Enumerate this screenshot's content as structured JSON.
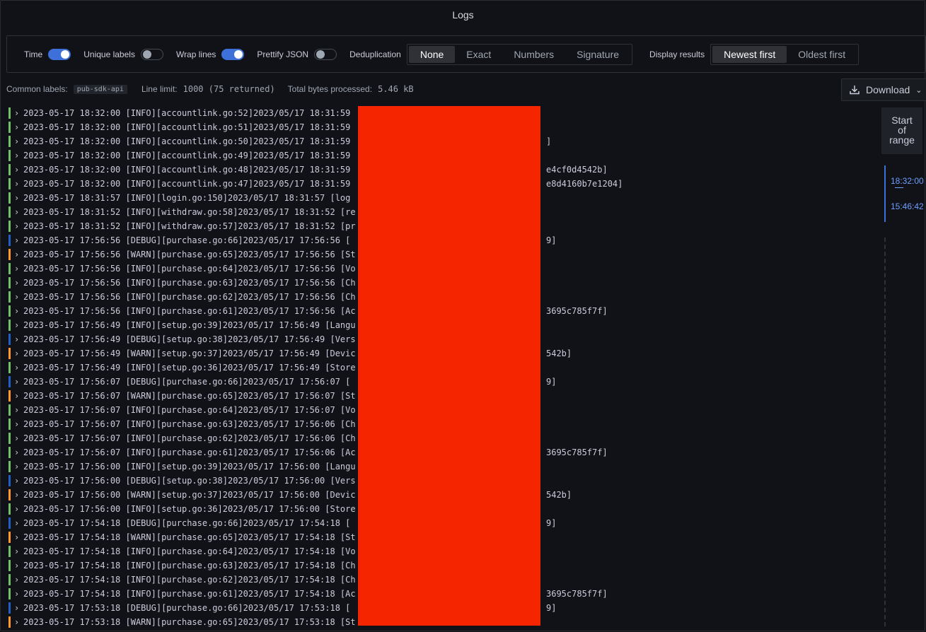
{
  "panel": {
    "title": "Logs"
  },
  "options": {
    "time": {
      "label": "Time",
      "on": true
    },
    "unique_labels": {
      "label": "Unique labels",
      "on": false
    },
    "wrap_lines": {
      "label": "Wrap lines",
      "on": true
    },
    "prettify_json": {
      "label": "Prettify JSON",
      "on": false
    },
    "dedup": {
      "label": "Deduplication",
      "choices": [
        "None",
        "Exact",
        "Numbers",
        "Signature"
      ],
      "selected": "None"
    },
    "display": {
      "label": "Display results",
      "choices": [
        "Newest first",
        "Oldest first"
      ],
      "selected": "Newest first"
    }
  },
  "meta": {
    "common_labels_label": "Common labels:",
    "common_labels_value": "pub-sdk-api",
    "line_limit_label": "Line limit:",
    "line_limit_value": "1000 (75 returned)",
    "bytes_label": "Total bytes processed:",
    "bytes_value": "5.46 kB"
  },
  "download": {
    "label": "Download"
  },
  "range": {
    "head": [
      "Start",
      "of",
      "range"
    ],
    "top": "18:32:00",
    "sep": "—",
    "bottom": "15:46:42"
  },
  "colors": {
    "info": "#73bf69",
    "debug": "#1f60c4",
    "warn": "#ff9830",
    "accent": "#3d71d9",
    "redaction": "#f52500"
  },
  "logs": [
    {
      "level": "info",
      "left": "2023-05-17 18:32:00 [INFO][accountlink.go:52]2023/05/17 18:31:59",
      "right": ""
    },
    {
      "level": "info",
      "left": "2023-05-17 18:32:00 [INFO][accountlink.go:51]2023/05/17 18:31:59",
      "right": ""
    },
    {
      "level": "info",
      "left": "2023-05-17 18:32:00 [INFO][accountlink.go:50]2023/05/17 18:31:59",
      "right": "]"
    },
    {
      "level": "info",
      "left": "2023-05-17 18:32:00 [INFO][accountlink.go:49]2023/05/17 18:31:59",
      "right": ""
    },
    {
      "level": "info",
      "left": "2023-05-17 18:32:00 [INFO][accountlink.go:48]2023/05/17 18:31:59",
      "right": "e4cf0d4542b]"
    },
    {
      "level": "info",
      "left": "2023-05-17 18:32:00 [INFO][accountlink.go:47]2023/05/17 18:31:59",
      "right": "e8d4160b7e1204]"
    },
    {
      "level": "info",
      "left": "2023-05-17 18:31:57 [INFO][login.go:150]2023/05/17 18:31:57 [log",
      "right": ""
    },
    {
      "level": "info",
      "left": "2023-05-17 18:31:52 [INFO][withdraw.go:58]2023/05/17 18:31:52 [re",
      "right": ""
    },
    {
      "level": "info",
      "left": "2023-05-17 18:31:52 [INFO][withdraw.go:57]2023/05/17 18:31:52 [pr",
      "right": ""
    },
    {
      "level": "debug",
      "left": "2023-05-17 17:56:56 [DEBUG][purchase.go:66]2023/05/17 17:56:56 [",
      "right": "9]"
    },
    {
      "level": "warn",
      "left": "2023-05-17 17:56:56 [WARN][purchase.go:65]2023/05/17 17:56:56 [St",
      "right": ""
    },
    {
      "level": "info",
      "left": "2023-05-17 17:56:56 [INFO][purchase.go:64]2023/05/17 17:56:56 [Vo",
      "right": ""
    },
    {
      "level": "info",
      "left": "2023-05-17 17:56:56 [INFO][purchase.go:63]2023/05/17 17:56:56 [Ch",
      "right": ""
    },
    {
      "level": "info",
      "left": "2023-05-17 17:56:56 [INFO][purchase.go:62]2023/05/17 17:56:56 [Ch",
      "right": ""
    },
    {
      "level": "info",
      "left": "2023-05-17 17:56:56 [INFO][purchase.go:61]2023/05/17 17:56:56 [Ac",
      "right": "3695c785f7f]"
    },
    {
      "level": "info",
      "left": "2023-05-17 17:56:49 [INFO][setup.go:39]2023/05/17 17:56:49 [Langu",
      "right": ""
    },
    {
      "level": "debug",
      "left": "2023-05-17 17:56:49 [DEBUG][setup.go:38]2023/05/17 17:56:49 [Vers",
      "right": ""
    },
    {
      "level": "warn",
      "left": "2023-05-17 17:56:49 [WARN][setup.go:37]2023/05/17 17:56:49 [Devic",
      "right": "542b]"
    },
    {
      "level": "info",
      "left": "2023-05-17 17:56:49 [INFO][setup.go:36]2023/05/17 17:56:49 [Store",
      "right": ""
    },
    {
      "level": "debug",
      "left": "2023-05-17 17:56:07 [DEBUG][purchase.go:66]2023/05/17 17:56:07 [",
      "right": "9]"
    },
    {
      "level": "warn",
      "left": "2023-05-17 17:56:07 [WARN][purchase.go:65]2023/05/17 17:56:07 [St",
      "right": ""
    },
    {
      "level": "info",
      "left": "2023-05-17 17:56:07 [INFO][purchase.go:64]2023/05/17 17:56:07 [Vo",
      "right": ""
    },
    {
      "level": "info",
      "left": "2023-05-17 17:56:07 [INFO][purchase.go:63]2023/05/17 17:56:06 [Ch",
      "right": ""
    },
    {
      "level": "info",
      "left": "2023-05-17 17:56:07 [INFO][purchase.go:62]2023/05/17 17:56:06 [Ch",
      "right": ""
    },
    {
      "level": "info",
      "left": "2023-05-17 17:56:07 [INFO][purchase.go:61]2023/05/17 17:56:06 [Ac",
      "right": "3695c785f7f]"
    },
    {
      "level": "info",
      "left": "2023-05-17 17:56:00 [INFO][setup.go:39]2023/05/17 17:56:00 [Langu",
      "right": ""
    },
    {
      "level": "debug",
      "left": "2023-05-17 17:56:00 [DEBUG][setup.go:38]2023/05/17 17:56:00 [Vers",
      "right": ""
    },
    {
      "level": "warn",
      "left": "2023-05-17 17:56:00 [WARN][setup.go:37]2023/05/17 17:56:00 [Devic",
      "right": "542b]"
    },
    {
      "level": "info",
      "left": "2023-05-17 17:56:00 [INFO][setup.go:36]2023/05/17 17:56:00 [Store",
      "right": ""
    },
    {
      "level": "debug",
      "left": "2023-05-17 17:54:18 [DEBUG][purchase.go:66]2023/05/17 17:54:18 [",
      "right": "9]"
    },
    {
      "level": "warn",
      "left": "2023-05-17 17:54:18 [WARN][purchase.go:65]2023/05/17 17:54:18 [St",
      "right": ""
    },
    {
      "level": "info",
      "left": "2023-05-17 17:54:18 [INFO][purchase.go:64]2023/05/17 17:54:18 [Vo",
      "right": ""
    },
    {
      "level": "info",
      "left": "2023-05-17 17:54:18 [INFO][purchase.go:63]2023/05/17 17:54:18 [Ch",
      "right": ""
    },
    {
      "level": "info",
      "left": "2023-05-17 17:54:18 [INFO][purchase.go:62]2023/05/17 17:54:18 [Ch",
      "right": ""
    },
    {
      "level": "info",
      "left": "2023-05-17 17:54:18 [INFO][purchase.go:61]2023/05/17 17:54:18 [Ac",
      "right": "3695c785f7f]"
    },
    {
      "level": "debug",
      "left": "2023-05-17 17:53:18 [DEBUG][purchase.go:66]2023/05/17 17:53:18 [",
      "right": "9]"
    },
    {
      "level": "warn",
      "left": "2023-05-17 17:53:18 [WARN][purchase.go:65]2023/05/17 17:53:18 [St",
      "right": ""
    }
  ]
}
